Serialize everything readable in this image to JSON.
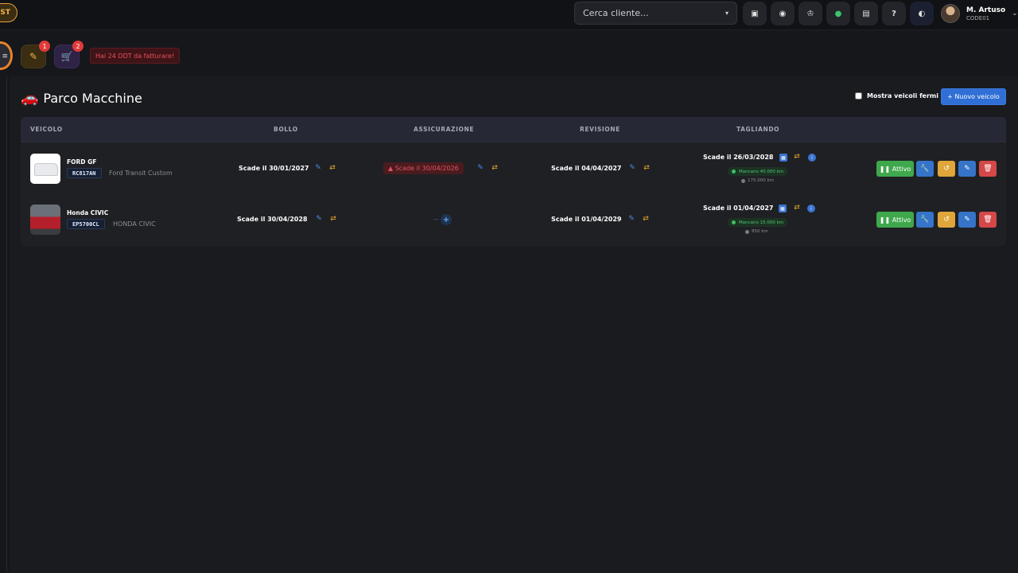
{
  "topbar": {
    "brand_text": "ST",
    "search": {
      "placeholder": "Cerca cliente...",
      "caret": "▾"
    },
    "buttons": [
      {
        "name": "screen-icon",
        "glyph": "▣"
      },
      {
        "name": "globe-icon",
        "glyph": "◉"
      },
      {
        "name": "chef-icon",
        "glyph": "♔"
      },
      {
        "name": "status-dot-icon",
        "glyph": "●"
      },
      {
        "name": "document-icon",
        "glyph": "▤"
      },
      {
        "name": "help-icon",
        "glyph": "?"
      },
      {
        "name": "theme-toggle-icon",
        "glyph": "◐"
      }
    ],
    "user": {
      "name": "M. Artuso",
      "code": "CODE01",
      "caret": "⌄"
    }
  },
  "subbar": {
    "ring_glyph": "≡",
    "tasks": {
      "glyph": "✎",
      "count": "1"
    },
    "cart": {
      "glyph": "🛒",
      "count": "2"
    },
    "alert": "Hai 24 DDT da fatturare!"
  },
  "page": {
    "icon": "🚗",
    "title": "Parco Macchine",
    "show_stopped_label": "Mostra veicoli fermi",
    "new_vehicle_label": "+ Nuovo veicolo"
  },
  "table": {
    "headers": [
      "VEICOLO",
      "BOLLO",
      "ASSICURAZIONE",
      "REVISIONE",
      "TAGLIANDO"
    ],
    "rows": [
      {
        "name": "FORD GF",
        "plate": "RC817AN",
        "model": "Ford Transit Custom",
        "bollo": "Scade il 30/01/2027",
        "assicurazione": "▲ Scade il 30/04/2026",
        "revisione": "Scade il 04/04/2027",
        "tagliando": "Scade il 26/03/2028",
        "km_left": "Mancano 40.000 km",
        "km": "175.000 km",
        "status": "❚❚ Attivo"
      },
      {
        "name": "Honda CIVIC",
        "plate": "EP5700CL",
        "model": "HONDA CIVIC",
        "bollo": "Scade il 30/04/2028",
        "assicurazione": "—",
        "revisione": "Scade il 01/04/2029",
        "tagliando": "Scade il 01/04/2027",
        "km_left": "Mancano 15.000 km",
        "km": "850 km",
        "status": "❚❚ Attivo"
      }
    ]
  },
  "icons": {
    "edit": "✎",
    "renew": "⇄",
    "calendar": "▦",
    "info": "i",
    "plus": "+",
    "wrench": "🔧",
    "history": "↺",
    "trash": "🗑"
  },
  "colors": {
    "background": "#16171b",
    "accent_blue": "#2f6fd6",
    "success": "#3fa84c",
    "warning": "#e0a63a",
    "danger": "#d54848"
  }
}
